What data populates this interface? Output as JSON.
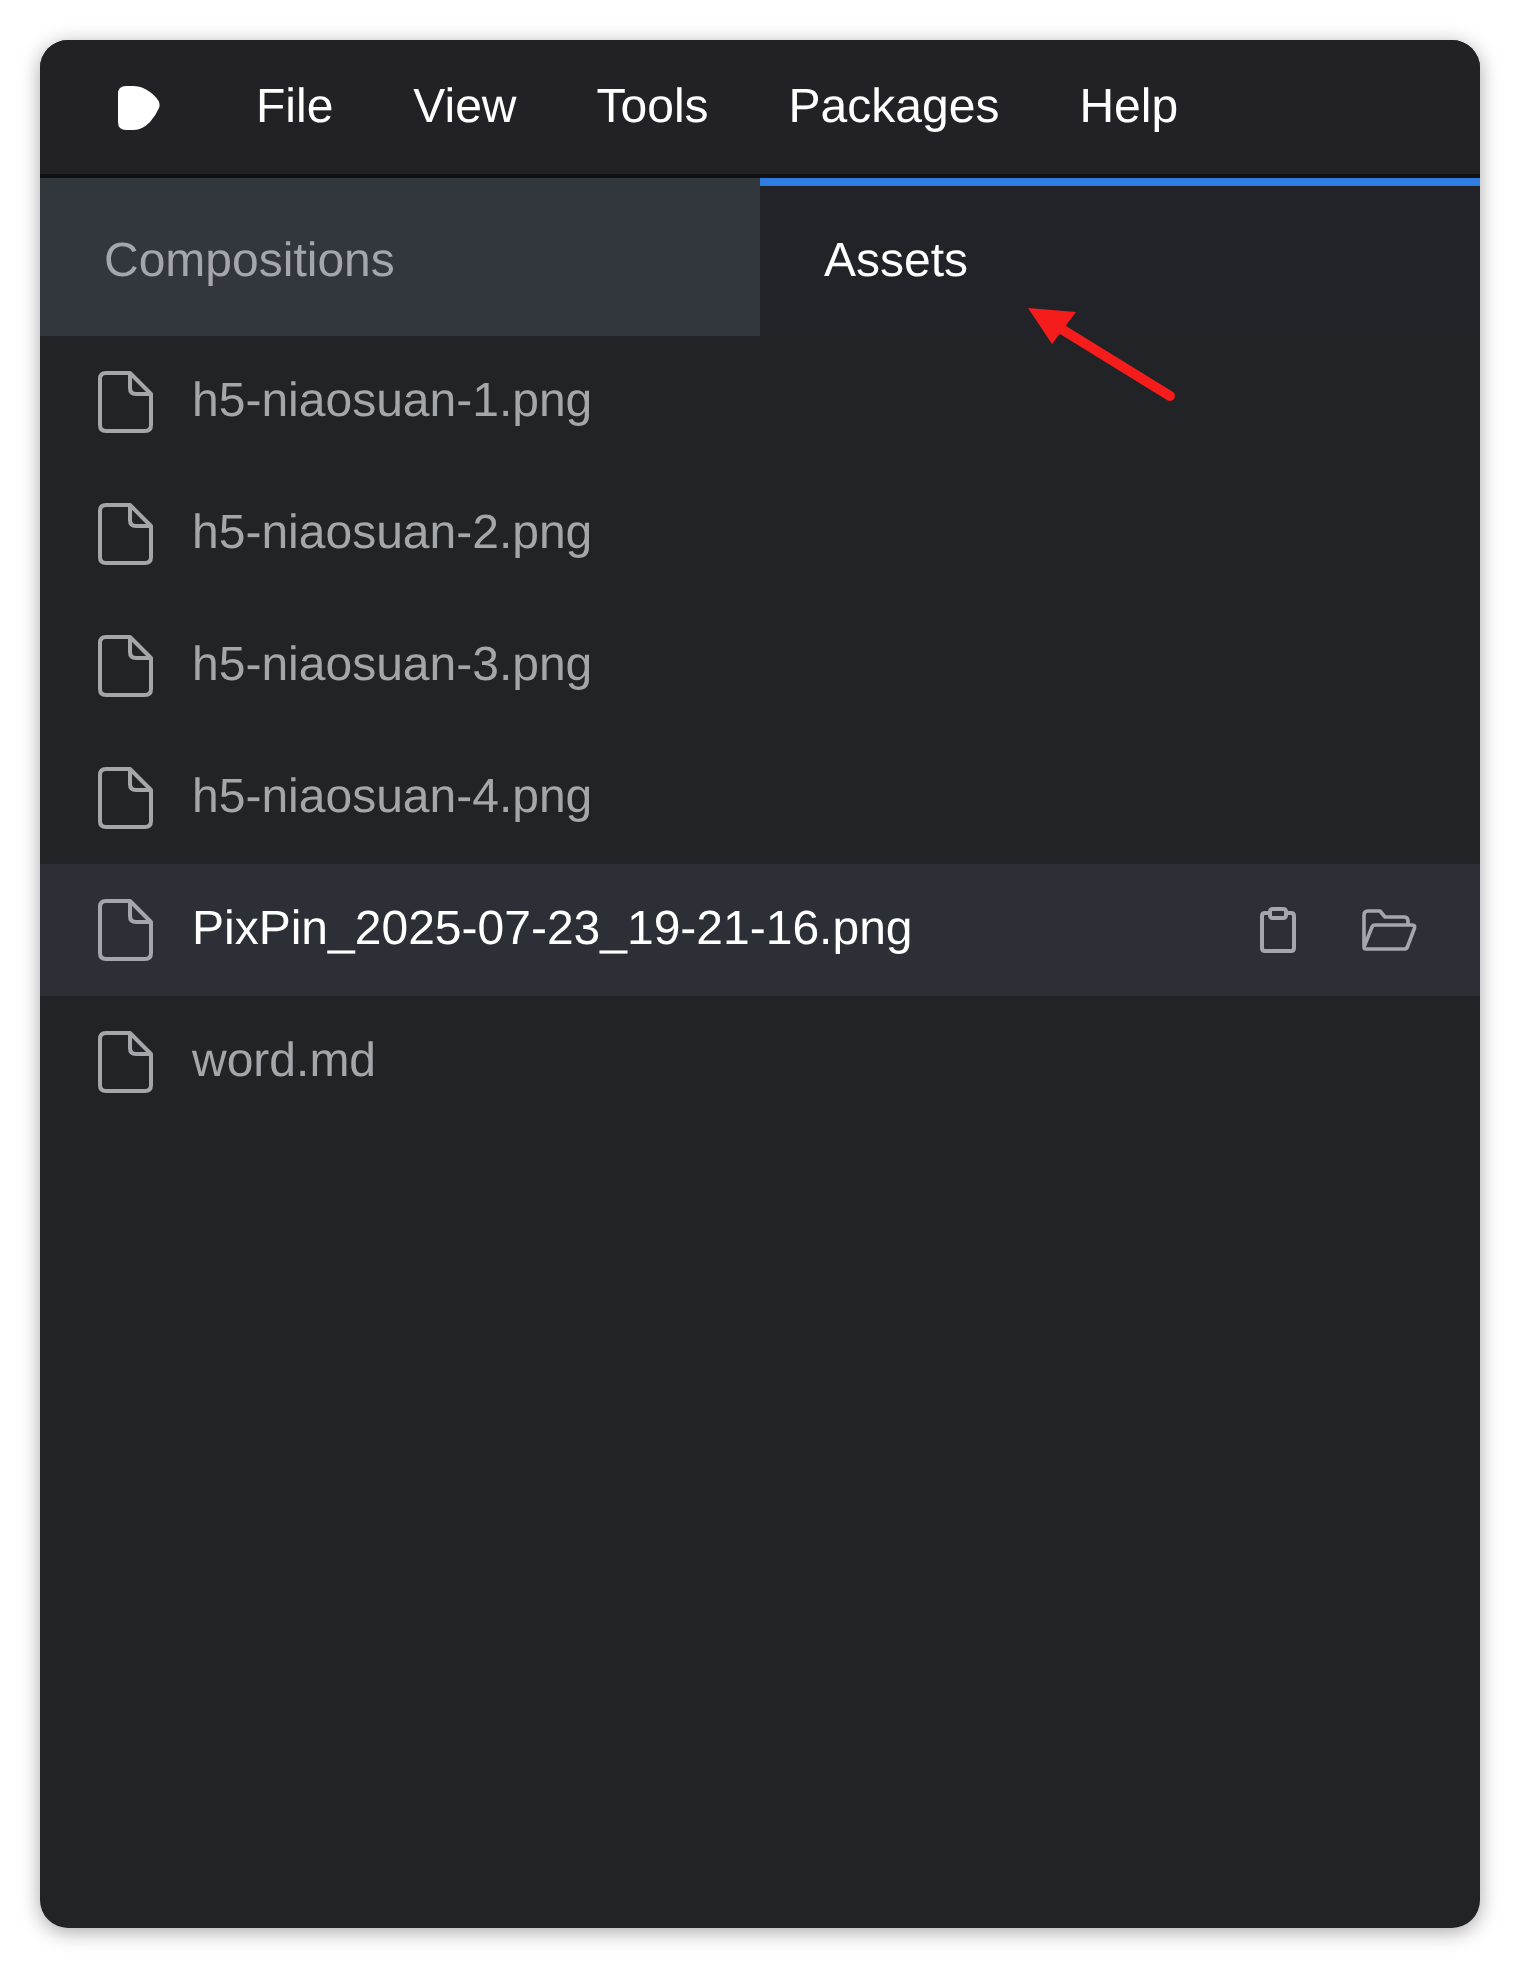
{
  "menu_bar": {
    "items": [
      "File",
      "View",
      "Tools",
      "Packages",
      "Help"
    ]
  },
  "tabs": [
    {
      "label": "Compositions",
      "selected": false
    },
    {
      "label": "Assets",
      "selected": true
    }
  ],
  "files": [
    {
      "name": "h5-niaosuan-1.png",
      "selected": false
    },
    {
      "name": "h5-niaosuan-2.png",
      "selected": false
    },
    {
      "name": "h5-niaosuan-3.png",
      "selected": false
    },
    {
      "name": "h5-niaosuan-4.png",
      "selected": false
    },
    {
      "name": "PixPin_2025-07-23_19-21-16.png",
      "selected": true
    },
    {
      "name": "word.md",
      "selected": false
    }
  ]
}
